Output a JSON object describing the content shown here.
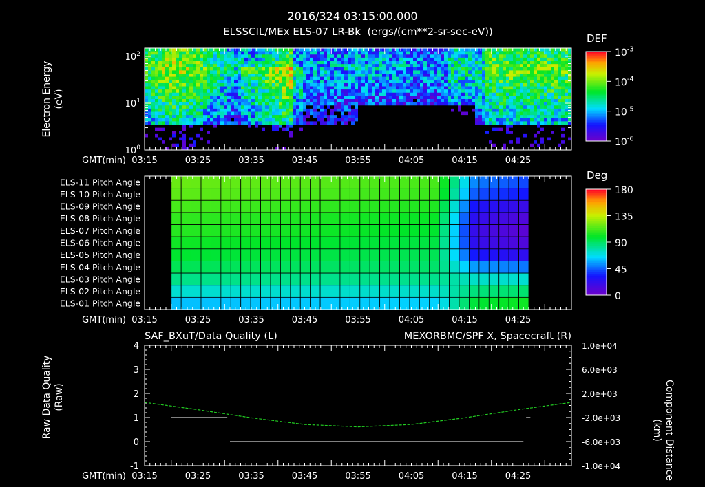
{
  "header": {
    "title": "2016/324 03:15:00.000",
    "subtitle": "ELSSCIL/MEx ELS-07 LR-Bk  (ergs/(cm**2-sr-sec-eV))"
  },
  "colors": {
    "background": "#000000",
    "foreground": "#ffffff",
    "green_trace": "#22cc22"
  },
  "time_axis": {
    "label": "GMT(min)",
    "ticks": [
      "03:15",
      "03:25",
      "03:35",
      "03:45",
      "03:55",
      "04:05",
      "04:15",
      "04:25"
    ],
    "range_min": [
      0,
      80
    ]
  },
  "chart_data": [
    {
      "type": "heatmap",
      "name": "energy-spectrogram",
      "ylabel": [
        "Electron Energy",
        "(eV)"
      ],
      "yscale": "log",
      "ylim": [
        1,
        150
      ],
      "yticks": [
        {
          "base": "10",
          "exp": "0",
          "value": 1
        },
        {
          "base": "10",
          "exp": "1",
          "value": 10
        },
        {
          "base": "10",
          "exp": "2",
          "value": 100
        }
      ],
      "colorbar": {
        "title": "DEF",
        "scale": "log",
        "ticks": [
          {
            "base": "10",
            "exp": "-3"
          },
          {
            "base": "10",
            "exp": "-4"
          },
          {
            "base": "10",
            "exp": "-5"
          },
          {
            "base": "10",
            "exp": "-6"
          }
        ],
        "tick_values": [
          0.001,
          0.0001,
          1e-05,
          1e-06
        ]
      }
    },
    {
      "type": "heatmap",
      "name": "pitch-angle-grid",
      "rows": [
        "ELS-11 Pitch Angle",
        "ELS-10 Pitch Angle",
        "ELS-09 Pitch Angle",
        "ELS-08 Pitch Angle",
        "ELS-07 Pitch Angle",
        "ELS-06 Pitch Angle",
        "ELS-05 Pitch Angle",
        "ELS-04 Pitch Angle",
        "ELS-03 Pitch Angle",
        "ELS-02 Pitch Angle",
        "ELS-01 Pitch Angle"
      ],
      "data_range_min": [
        5,
        72
      ],
      "bins": 36,
      "colorbar": {
        "title": "Deg",
        "ticks": [
          "180",
          "135",
          "90",
          "45",
          "0"
        ],
        "range": [
          0,
          180
        ]
      },
      "values_start": [
        118,
        116,
        112,
        108,
        106,
        102,
        98,
        92,
        84,
        72,
        60
      ],
      "values_end": [
        40,
        32,
        18,
        10,
        6,
        10,
        22,
        48,
        72,
        88,
        102
      ],
      "transition_min": [
        55,
        62
      ]
    },
    {
      "type": "line",
      "name": "quality-and-position",
      "title_left": "SAF_BXuT/Data Quality (L)",
      "title_right": "MEXORBMC/SPF X, Spacecraft (R)",
      "ylabel_left": [
        "Raw Data Quality",
        "(Raw)"
      ],
      "ylabel_right": [
        "Component Distance",
        "(km)"
      ],
      "ylim_left": [
        -1,
        4
      ],
      "yticks_left": [
        "4",
        "3",
        "2",
        "1",
        "0",
        "-1"
      ],
      "ylim_right": [
        -10000,
        10000
      ],
      "yticks_right": [
        "1.0e+04",
        "6.0e+03",
        "2.0e+03",
        "-2.0e+03",
        "-6.0e+03",
        "-1.0e+04"
      ],
      "series": [
        {
          "name": "SAF_BXuT/Data Quality",
          "axis": "left",
          "segments": [
            {
              "x": [
                5,
                15.5
              ],
              "y": [
                1,
                1
              ]
            },
            {
              "x": [
                16,
                71
              ],
              "y": [
                0,
                0
              ]
            },
            {
              "x": [
                71.5,
                72.3
              ],
              "y": [
                1,
                1
              ]
            }
          ]
        },
        {
          "name": "MEXORBMC/SPF X, Spacecraft",
          "axis": "right",
          "x": [
            0,
            10,
            20,
            30,
            40,
            50,
            60,
            70,
            80
          ],
          "y": [
            520,
            -700,
            -2050,
            -3150,
            -3550,
            -3150,
            -2050,
            -700,
            520
          ]
        }
      ]
    }
  ]
}
